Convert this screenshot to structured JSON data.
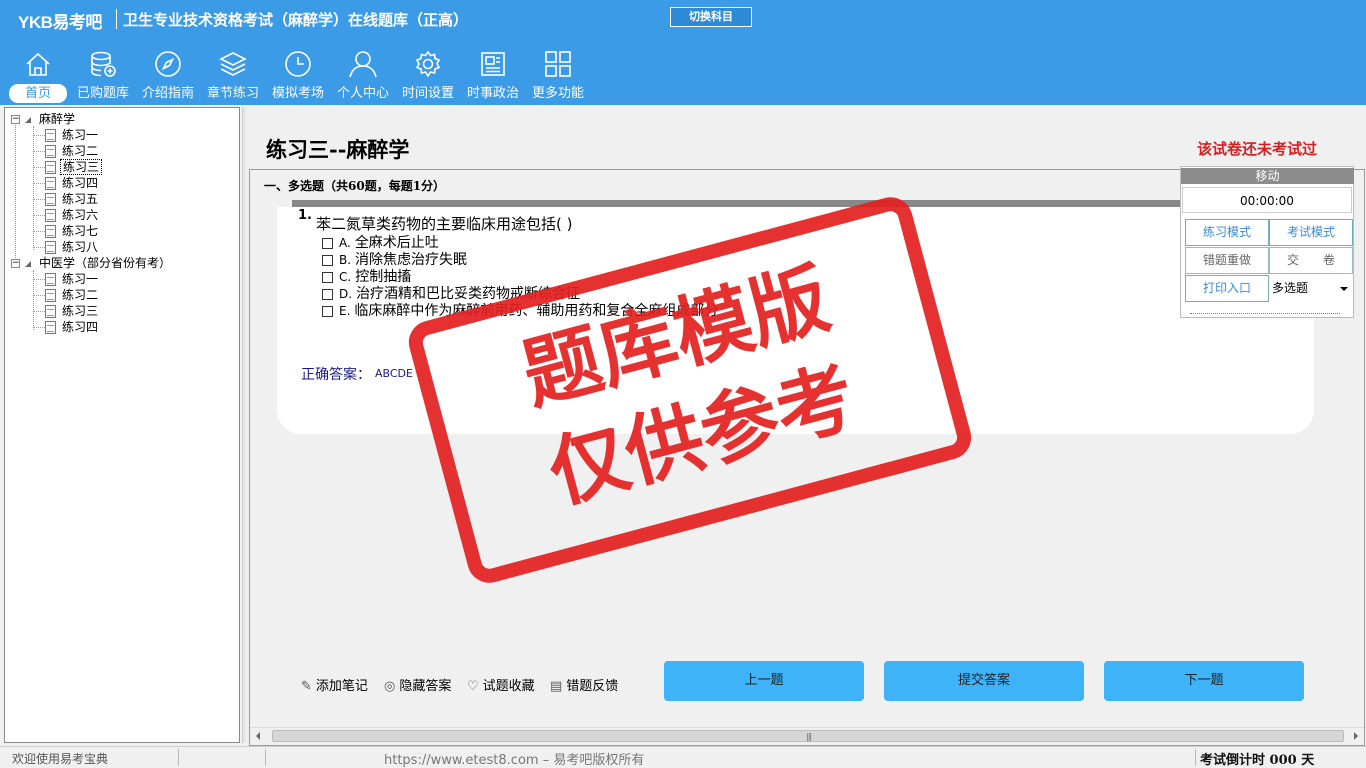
{
  "app": {
    "logo": "YKB易考吧",
    "title": "卫生专业技术资格考试（麻醉学）在线题库（正高）",
    "switch_subject": "切换科目"
  },
  "nav": [
    {
      "label": "首页",
      "icon": "home-icon",
      "active": true
    },
    {
      "label": "已购题库",
      "icon": "database-add-icon"
    },
    {
      "label": "介绍指南",
      "icon": "compass-icon"
    },
    {
      "label": "章节练习",
      "icon": "layers-icon"
    },
    {
      "label": "模拟考场",
      "icon": "clock-icon"
    },
    {
      "label": "个人中心",
      "icon": "user-icon"
    },
    {
      "label": "时间设置",
      "icon": "gear-icon"
    },
    {
      "label": "时事政治",
      "icon": "news-icon"
    },
    {
      "label": "更多功能",
      "icon": "grid-icon"
    }
  ],
  "tree": {
    "groups": [
      {
        "label": "麻醉学",
        "items": [
          "练习一",
          "练习二",
          "练习三",
          "练习四",
          "练习五",
          "练习六",
          "练习七",
          "练习八"
        ],
        "selected_index": 2
      },
      {
        "label": "中医学（部分省份有考）",
        "items": [
          "练习一",
          "练习二",
          "练习三",
          "练习四"
        ]
      }
    ]
  },
  "paper": {
    "title": "练习三--麻醉学",
    "status": "该试卷还未考试过",
    "section": "一、多选题（共60题，每题1分）"
  },
  "question": {
    "number": "1.",
    "stem": "苯二氮草类药物的主要临床用途包括(   )",
    "options": [
      {
        "letter": "A.",
        "text": "全麻术后止吐"
      },
      {
        "letter": "B.",
        "text": "消除焦虑治疗失眠"
      },
      {
        "letter": "C.",
        "text": "控制抽搐"
      },
      {
        "letter": "D.",
        "text": "治疗酒精和巴比妥类药物戒断综合征"
      },
      {
        "letter": "E.",
        "text": "临床麻醉中作为麻醉前用药、辅助用药和复合全麻组成部分"
      }
    ],
    "answer_label": "正确答案：",
    "answer_value": "ABCDE"
  },
  "side_panel": {
    "move": "移动",
    "timer": "00:00:00",
    "practice_mode": "练习模式",
    "exam_mode": "考试模式",
    "redo_wrong": "错题重做",
    "submit_paper": "交　　卷",
    "print_entry": "打印入口",
    "question_type": "多选题"
  },
  "tools": {
    "add_note": "添加笔记",
    "hide_answer": "隐藏答案",
    "favorite": "试题收藏",
    "report_error": "错题反馈"
  },
  "buttons": {
    "prev": "上一题",
    "submit": "提交答案",
    "next": "下一题"
  },
  "status_bar": {
    "welcome": "欢迎使用易考宝典",
    "copyright": "https://www.etest8.com – 易考吧版权所有",
    "countdown": "考试倒计时 000 天"
  },
  "watermark": {
    "line1": "题库模版",
    "line2": "仅供参考"
  },
  "colors": {
    "header_blue": "#3b9be6",
    "action_blue": "#3fb3f8",
    "stamp_red": "#e3201f",
    "status_red": "#d42020"
  }
}
